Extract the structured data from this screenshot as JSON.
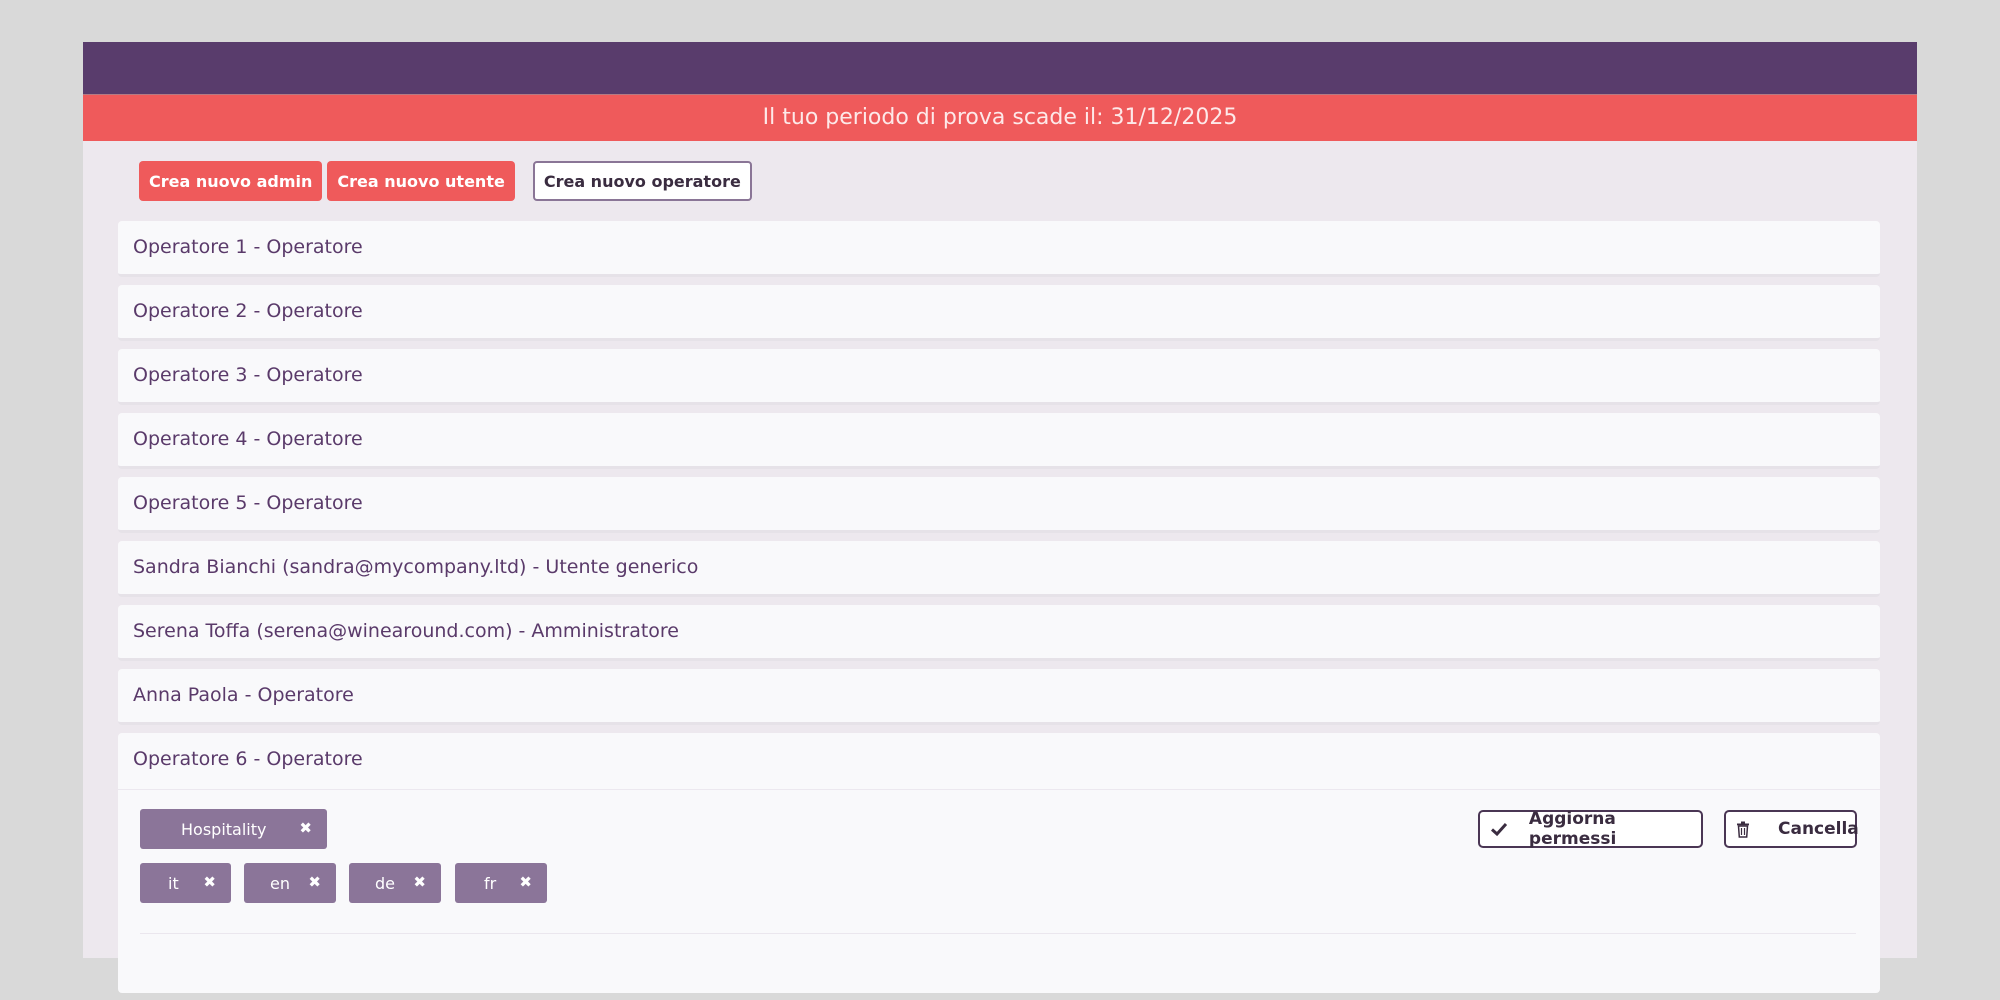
{
  "banner": {
    "trial_text": "Il tuo periodo di prova scade il: 31/12/2025"
  },
  "actions": {
    "create_admin": "Crea nuovo admin",
    "create_user": "Crea nuovo utente",
    "create_operator": "Crea nuovo operatore"
  },
  "users": [
    "Operatore 1 - Operatore",
    "Operatore 2 - Operatore",
    "Operatore 3 - Operatore",
    "Operatore 4 - Operatore",
    "Operatore 5 - Operatore",
    "Sandra Bianchi (sandra@mycompany.ltd) - Utente generico",
    "Serena Toffa (serena@winearound.com) - Amministratore",
    "Anna Paola - Operatore"
  ],
  "expanded_user": {
    "label": "Operatore 6 - Operatore",
    "category_tag": "Hospitality",
    "language_tags": [
      "it",
      "en",
      "de",
      "fr"
    ],
    "update_button": "Aggiorna permessi",
    "delete_button": "Cancella"
  },
  "icons": {
    "remove": "close-icon",
    "update": "check-icon",
    "delete": "trash-icon"
  },
  "colors": {
    "topbar": "#593c6c",
    "banner": "#ef5a5b",
    "tag": "#8b7599",
    "text": "#5a3a6a"
  }
}
